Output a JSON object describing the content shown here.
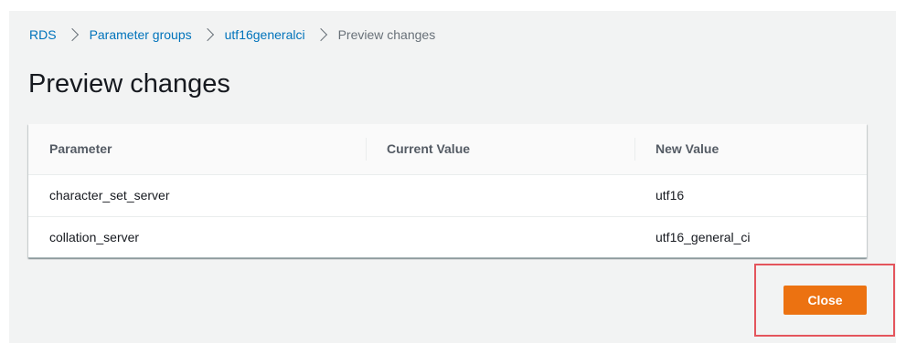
{
  "breadcrumb": {
    "items": [
      {
        "label": "RDS"
      },
      {
        "label": "Parameter groups"
      },
      {
        "label": "utf16generalci"
      }
    ],
    "current": "Preview changes"
  },
  "page": {
    "title": "Preview changes"
  },
  "table": {
    "headers": [
      "Parameter",
      "Current Value",
      "New Value"
    ],
    "rows": [
      [
        "character_set_server",
        "",
        "utf16"
      ],
      [
        "collation_server",
        "",
        "utf16_general_ci"
      ]
    ]
  },
  "actions": {
    "close_label": "Close"
  },
  "colors": {
    "panel_background": "#f2f3f3",
    "link": "#0073bb",
    "primary_button": "#ec7211",
    "highlight_border": "#e4555c"
  }
}
